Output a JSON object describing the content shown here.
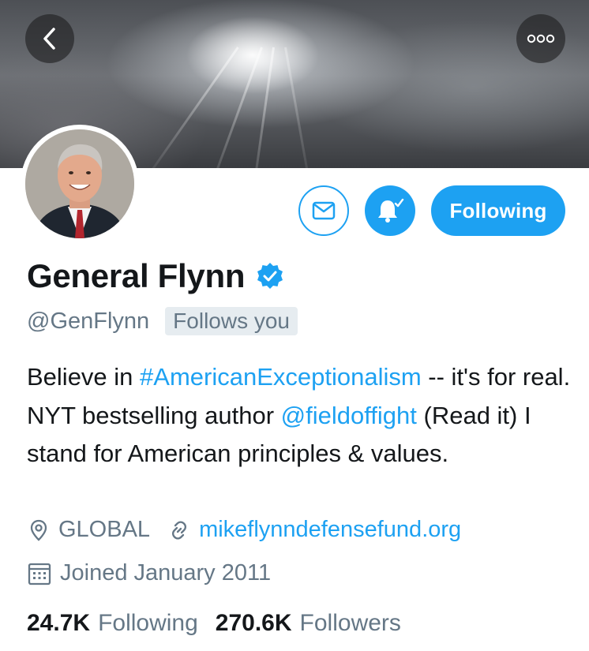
{
  "profile": {
    "name": "General Flynn",
    "handle": "@GenFlynn",
    "follows_you": "Follows you",
    "bio": {
      "t1": "Believe in ",
      "hashtag": "#AmericanExceptionalism",
      "t2": " -- it's for real. NYT bestselling author ",
      "mention": "@fieldoffight",
      "t3": " (Read it) I stand for American principles & values."
    },
    "location": "GLOBAL",
    "website": "mikeflynndefensefund.org",
    "joined": "Joined January 2011"
  },
  "actions": {
    "following_label": "Following"
  },
  "stats": {
    "following_count": "24.7K",
    "following_label": "Following",
    "followers_count": "270.6K",
    "followers_label": "Followers"
  },
  "icons": {
    "back": "chevron-left-icon",
    "more": "more-icon",
    "message": "envelope-icon",
    "notifications": "bell-icon",
    "verified": "verified-badge-icon",
    "location": "location-pin-icon",
    "link": "link-icon",
    "calendar": "calendar-icon"
  },
  "colors": {
    "accent": "#1da1f2",
    "text_primary": "#14171a",
    "text_secondary": "#657786",
    "badge_bg": "#e6ecf0"
  }
}
